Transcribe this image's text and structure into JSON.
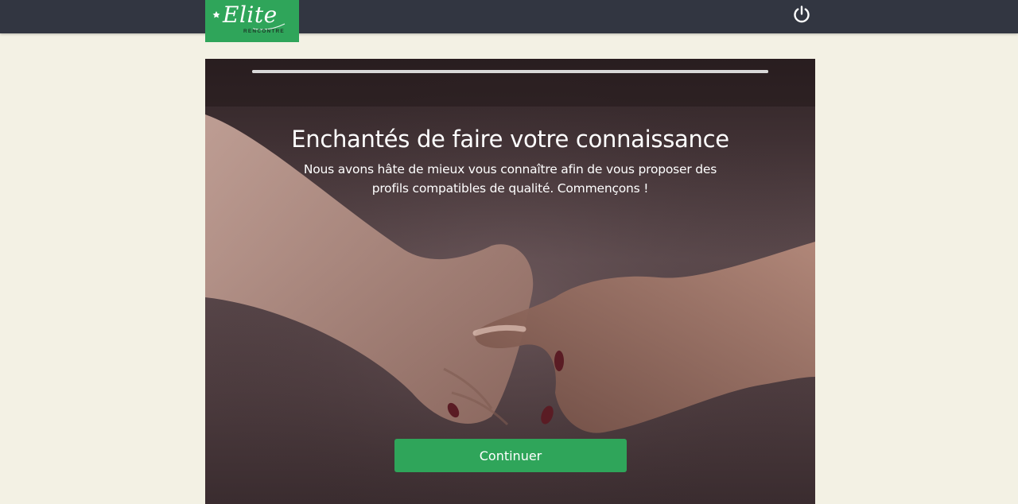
{
  "header": {
    "logo_text": "Elite",
    "logo_subtitle": "RENCONTRE",
    "power_icon": "power-icon"
  },
  "onboarding": {
    "progress_fraction": 1.0,
    "title": "Enchantés de faire votre connaissance",
    "subtitle": "Nous avons hâte de mieux vous connaître afin de vous proposer des profils compatibles de qualité. Commençons !",
    "continue_label": "Continuer"
  },
  "colors": {
    "topbar": "#323641",
    "brand_green": "#2fa55a",
    "page_background": "#f3f1e4"
  }
}
